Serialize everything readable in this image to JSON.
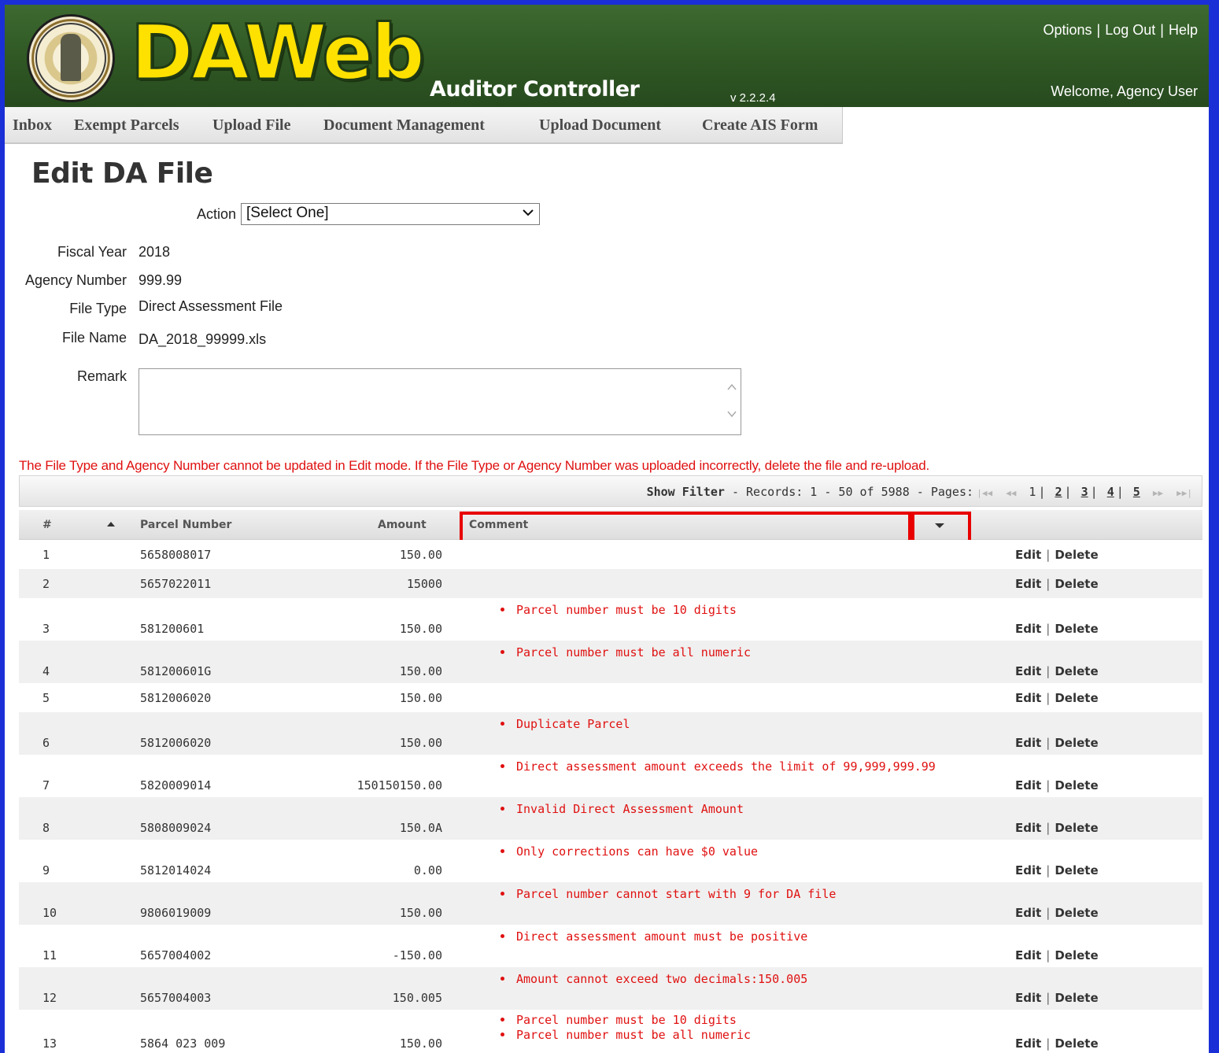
{
  "header": {
    "logo_text": "DAWeb",
    "subtitle": "Auditor Controller",
    "version": "v 2.2.2.4",
    "links": [
      "Options",
      "Log Out",
      "Help"
    ],
    "welcome": "Welcome, Agency User",
    "seal_text": "COUNTY OF LOS ANGELES CALIFORNIA"
  },
  "nav": {
    "items": [
      "Inbox",
      "Exempt Parcels",
      "Upload File",
      "Document Management",
      "Upload Document",
      "Create AIS Form"
    ]
  },
  "page": {
    "title": "Edit DA File",
    "action_label": "Action",
    "action_value": "[Select One]",
    "fields": {
      "fiscal_year_label": "Fiscal Year",
      "fiscal_year": "2018",
      "agency_number_label": "Agency Number",
      "agency_number": "999.99",
      "file_type_label": "File Type",
      "file_type": "Direct Assessment File",
      "file_name_label": "File Name",
      "file_name": "DA_2018_99999.xls",
      "remark_label": "Remark",
      "remark_value": ""
    },
    "warning": "The File Type and Agency Number cannot be updated in Edit mode. If the File Type or Agency Number was uploaded incorrectly, delete the file and re-upload."
  },
  "grid": {
    "show_filter": "Show Filter",
    "records_text": "-   Records: 1 - 50 of 5988 - Pages:",
    "pages": [
      "1",
      "2",
      "3",
      "4",
      "5"
    ],
    "current_page": "1",
    "columns": {
      "num": "#",
      "parcel": "Parcel Number",
      "amount": "Amount",
      "comment": "Comment"
    },
    "action_edit": "Edit",
    "action_delete": "Delete",
    "rows": [
      {
        "num": "1",
        "parcel": "5658008017",
        "amount": "150.00",
        "comments": []
      },
      {
        "num": "2",
        "parcel": "5657022011",
        "amount": "15000",
        "comments": []
      },
      {
        "num": "3",
        "parcel": "581200601",
        "amount": "150.00",
        "comments": [
          "Parcel number must be 10 digits"
        ]
      },
      {
        "num": "4",
        "parcel": "581200601G",
        "amount": "150.00",
        "comments": [
          "Parcel number must be all numeric"
        ]
      },
      {
        "num": "5",
        "parcel": "5812006020",
        "amount": "150.00",
        "comments": []
      },
      {
        "num": "6",
        "parcel": "5812006020",
        "amount": "150.00",
        "comments": [
          "Duplicate Parcel"
        ]
      },
      {
        "num": "7",
        "parcel": "5820009014",
        "amount": "150150150.00",
        "comments": [
          "Direct assessment amount exceeds the limit of 99,999,999.99"
        ]
      },
      {
        "num": "8",
        "parcel": "5808009024",
        "amount": "150.0A",
        "comments": [
          "Invalid Direct Assessment Amount"
        ]
      },
      {
        "num": "9",
        "parcel": "5812014024",
        "amount": "0.00",
        "comments": [
          "Only corrections can have $0 value"
        ]
      },
      {
        "num": "10",
        "parcel": "9806019009",
        "amount": "150.00",
        "comments": [
          "Parcel number cannot start with 9 for DA file"
        ]
      },
      {
        "num": "11",
        "parcel": "5657004002",
        "amount": "-150.00",
        "comments": [
          "Direct assessment amount must be positive"
        ]
      },
      {
        "num": "12",
        "parcel": "5657004003",
        "amount": "150.005",
        "comments": [
          "Amount cannot exceed two decimals:150.005"
        ]
      },
      {
        "num": "13",
        "parcel": "5864 023 009",
        "amount": "150.00",
        "comments": [
          "Parcel number must be 10 digits",
          "Parcel number must be all numeric"
        ]
      }
    ]
  },
  "colors": {
    "header_green": "#2f5724",
    "logo_yellow": "#ffe100",
    "error_red": "#e01010",
    "highlight_red": "#e80000",
    "frame_blue": "#1a2fd6"
  }
}
